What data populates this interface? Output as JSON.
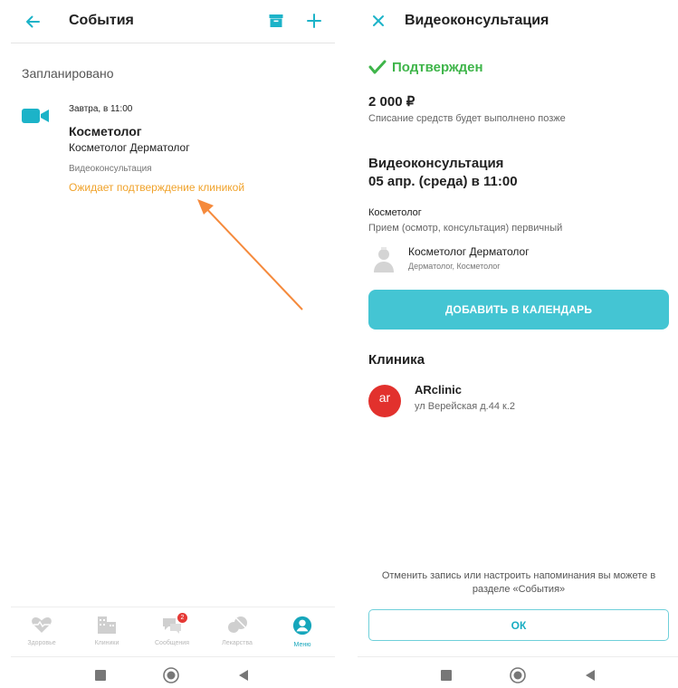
{
  "left": {
    "header": {
      "title": "События"
    },
    "section_title": "Запланировано",
    "event": {
      "datetime": "Завтра, в 11:00",
      "specialty": "Косметолог",
      "doctor": "Косметолог Дерматолог",
      "type": "Видеоконсультация",
      "status": "Ожидает подтверждение клиникой"
    },
    "tabs": [
      {
        "label": "Здоровье",
        "icon": "heart-pulse-icon"
      },
      {
        "label": "Клиники",
        "icon": "clinic-building-icon"
      },
      {
        "label": "Сообщения",
        "icon": "chat-bubbles-icon",
        "badge": "2"
      },
      {
        "label": "Лекарства",
        "icon": "pills-icon"
      },
      {
        "label": "Меню",
        "icon": "profile-menu-icon"
      }
    ]
  },
  "right": {
    "header": {
      "title": "Видеоконсультация"
    },
    "status": "Подтвержден",
    "price": "2 000 ₽",
    "price_note": "Списание средств будет выполнено позже",
    "consult_title": "Видеоконсультация",
    "consult_date": "05 апр. (среда) в 11:00",
    "specialty": "Косметолог",
    "service": "Прием (осмотр, консультация) первичный",
    "doctor": {
      "name": "Косметолог Дерматолог",
      "specs": "Дерматолог, Косметолог"
    },
    "add_calendar": "ДОБАВИТЬ В КАЛЕНДАРЬ",
    "clinic_heading": "Клиника",
    "clinic": {
      "name": "ARclinic",
      "address": "ул Верейская д.44 к.2",
      "logo_text": "ar"
    },
    "footer_note": "Отменить запись или настроить напоминания вы можете в разделе «События»",
    "ok": "ОК"
  },
  "colors": {
    "accent": "#1cb3c8",
    "status_pending": "#f0a22a",
    "status_ok": "#3fb54a",
    "arrow": "#f58a3c",
    "clinic_logo": "#e2312d"
  }
}
